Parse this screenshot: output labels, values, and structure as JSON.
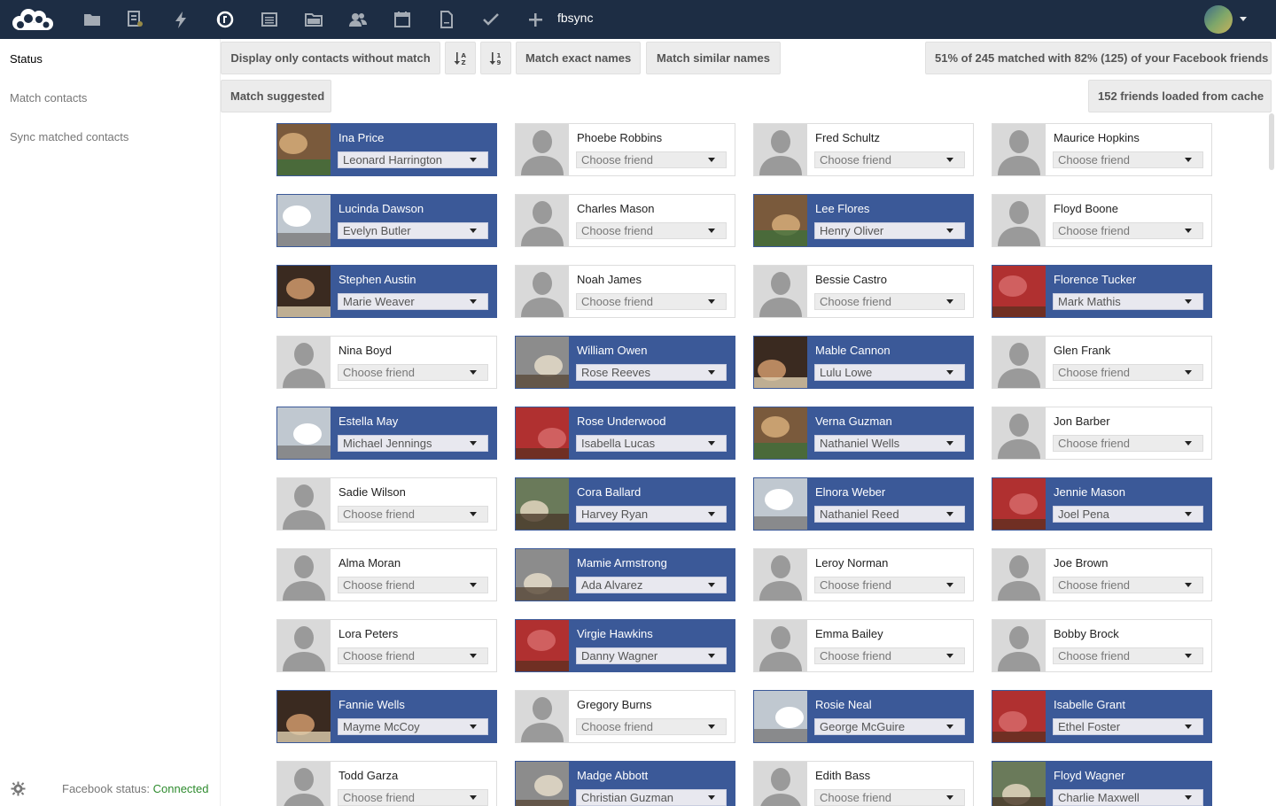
{
  "header": {
    "app_name": "fbsync",
    "apps": [
      {
        "icon": "folder-icon"
      },
      {
        "icon": "gallery-icon"
      },
      {
        "icon": "activity-icon"
      },
      {
        "icon": "fbsync-icon"
      },
      {
        "icon": "news-icon"
      },
      {
        "icon": "files-icon"
      },
      {
        "icon": "contacts-icon"
      },
      {
        "icon": "calendar-icon"
      },
      {
        "icon": "document-icon"
      },
      {
        "icon": "tasks-icon"
      },
      {
        "icon": "add-icon"
      }
    ]
  },
  "sidebar": {
    "items": [
      {
        "label": "Status"
      },
      {
        "label": "Match contacts"
      },
      {
        "label": "Sync matched contacts"
      }
    ],
    "fb_status_label": "Facebook status:",
    "fb_status_value": "Connected"
  },
  "toolbar": {
    "only_without_match": "Display only contacts without match",
    "match_exact": "Match exact names",
    "match_similar": "Match similar names",
    "match_suggested": "Match suggested",
    "stats": "51% of 245 matched with 82% (125) of your Facebook friends",
    "cache": "152 friends loaded from cache"
  },
  "colors": {
    "header_bg": "#1d2d44",
    "facebook_blue": "#3b5998",
    "connected_green": "#2e8b2e"
  },
  "cards": [
    {
      "name": "Ina Price",
      "friend": "Leonard Harrington",
      "matched": true
    },
    {
      "name": "Phoebe Robbins",
      "friend": "Choose friend",
      "matched": false
    },
    {
      "name": "Fred Schultz",
      "friend": "Choose friend",
      "matched": false
    },
    {
      "name": "Maurice Hopkins",
      "friend": "Choose friend",
      "matched": false
    },
    {
      "name": "Lucinda Dawson",
      "friend": "Evelyn Butler",
      "matched": true
    },
    {
      "name": "Charles Mason",
      "friend": "Choose friend",
      "matched": false
    },
    {
      "name": "Lee Flores",
      "friend": "Henry Oliver",
      "matched": true
    },
    {
      "name": "Floyd Boone",
      "friend": "Choose friend",
      "matched": false
    },
    {
      "name": "Stephen Austin",
      "friend": "Marie Weaver",
      "matched": true
    },
    {
      "name": "Noah James",
      "friend": "Choose friend",
      "matched": false
    },
    {
      "name": "Bessie Castro",
      "friend": "Choose friend",
      "matched": false
    },
    {
      "name": "Florence Tucker",
      "friend": "Mark Mathis",
      "matched": true
    },
    {
      "name": "Nina Boyd",
      "friend": "Choose friend",
      "matched": false
    },
    {
      "name": "William Owen",
      "friend": "Rose Reeves",
      "matched": true
    },
    {
      "name": "Mable Cannon",
      "friend": "Lulu Lowe",
      "matched": true
    },
    {
      "name": "Glen Frank",
      "friend": "Choose friend",
      "matched": false
    },
    {
      "name": "Estella May",
      "friend": "Michael Jennings",
      "matched": true
    },
    {
      "name": "Rose Underwood",
      "friend": "Isabella Lucas",
      "matched": true
    },
    {
      "name": "Verna Guzman",
      "friend": "Nathaniel Wells",
      "matched": true
    },
    {
      "name": "Jon Barber",
      "friend": "Choose friend",
      "matched": false
    },
    {
      "name": "Sadie Wilson",
      "friend": "Choose friend",
      "matched": false
    },
    {
      "name": "Cora Ballard",
      "friend": "Harvey Ryan",
      "matched": true
    },
    {
      "name": "Elnora Weber",
      "friend": "Nathaniel Reed",
      "matched": true
    },
    {
      "name": "Jennie Mason",
      "friend": "Joel Pena",
      "matched": true
    },
    {
      "name": "Alma Moran",
      "friend": "Choose friend",
      "matched": false
    },
    {
      "name": "Mamie Armstrong",
      "friend": "Ada Alvarez",
      "matched": true
    },
    {
      "name": "Leroy Norman",
      "friend": "Choose friend",
      "matched": false
    },
    {
      "name": "Joe Brown",
      "friend": "Choose friend",
      "matched": false
    },
    {
      "name": "Lora Peters",
      "friend": "Choose friend",
      "matched": false
    },
    {
      "name": "Virgie Hawkins",
      "friend": "Danny Wagner",
      "matched": true
    },
    {
      "name": "Emma Bailey",
      "friend": "Choose friend",
      "matched": false
    },
    {
      "name": "Bobby Brock",
      "friend": "Choose friend",
      "matched": false
    },
    {
      "name": "Fannie Wells",
      "friend": "Mayme McCoy",
      "matched": true
    },
    {
      "name": "Gregory Burns",
      "friend": "Choose friend",
      "matched": false
    },
    {
      "name": "Rosie Neal",
      "friend": "George McGuire",
      "matched": true
    },
    {
      "name": "Isabelle Grant",
      "friend": "Ethel Foster",
      "matched": true
    },
    {
      "name": "Todd Garza",
      "friend": "Choose friend",
      "matched": false
    },
    {
      "name": "Madge Abbott",
      "friend": "Christian Guzman",
      "matched": true
    },
    {
      "name": "Edith Bass",
      "friend": "Choose friend",
      "matched": false
    },
    {
      "name": "Floyd Wagner",
      "friend": "Charlie Maxwell",
      "matched": true
    }
  ]
}
